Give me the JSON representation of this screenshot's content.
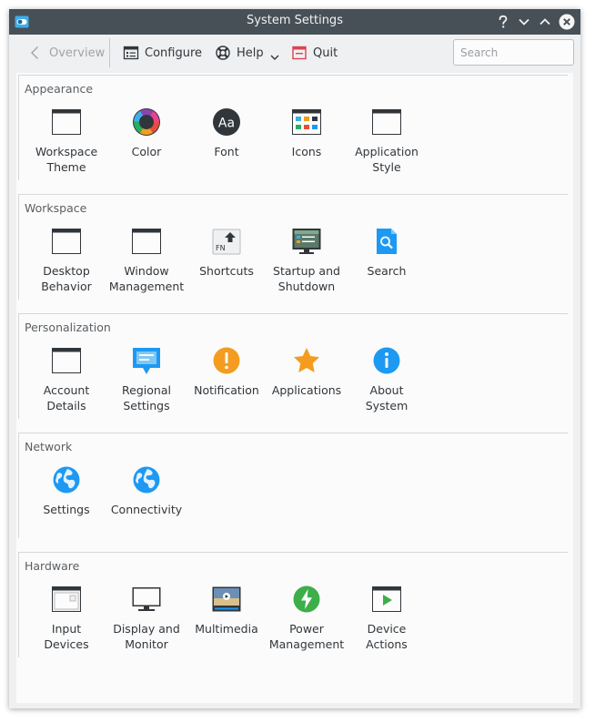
{
  "window": {
    "title": "System Settings"
  },
  "toolbar": {
    "overview_label": "Overview",
    "configure_label": "Configure",
    "help_label": "Help",
    "quit_label": "Quit",
    "search_placeholder": "Search"
  },
  "colors": {
    "titlebar": "#475057",
    "window_bg": "#eff0f1",
    "content_bg": "#fbfbfb",
    "accent": "#3daee9",
    "quit_red": "#da4453"
  },
  "groups": [
    {
      "title": "Appearance",
      "modules": [
        {
          "label": "Workspace\nTheme",
          "icon": "workspace-theme-icon"
        },
        {
          "label": "Color",
          "icon": "color-icon"
        },
        {
          "label": "Font",
          "icon": "font-icon"
        },
        {
          "label": "Icons",
          "icon": "icons-icon"
        },
        {
          "label": "Application\nStyle",
          "icon": "application-style-icon"
        }
      ]
    },
    {
      "title": "Workspace",
      "modules": [
        {
          "label": "Desktop\nBehavior",
          "icon": "desktop-behavior-icon"
        },
        {
          "label": "Window\nManagement",
          "icon": "window-management-icon"
        },
        {
          "label": "Shortcuts",
          "icon": "shortcuts-icon"
        },
        {
          "label": "Startup and\nShutdown",
          "icon": "startup-shutdown-icon"
        },
        {
          "label": "Search",
          "icon": "search-icon"
        }
      ]
    },
    {
      "title": "Personalization",
      "modules": [
        {
          "label": "Account\nDetails",
          "icon": "account-details-icon"
        },
        {
          "label": "Regional\nSettings",
          "icon": "regional-settings-icon"
        },
        {
          "label": "Notification",
          "icon": "notification-icon"
        },
        {
          "label": "Applications",
          "icon": "applications-icon"
        },
        {
          "label": "About\nSystem",
          "icon": "about-system-icon"
        }
      ]
    },
    {
      "title": "Network",
      "modules": [
        {
          "label": "Settings",
          "icon": "network-settings-icon"
        },
        {
          "label": "Connectivity",
          "icon": "connectivity-icon"
        }
      ]
    },
    {
      "title": "Hardware",
      "modules": [
        {
          "label": "Input\nDevices",
          "icon": "input-devices-icon"
        },
        {
          "label": "Display and\nMonitor",
          "icon": "display-monitor-icon"
        },
        {
          "label": "Multimedia",
          "icon": "multimedia-icon"
        },
        {
          "label": "Power\nManagement",
          "icon": "power-management-icon"
        },
        {
          "label": "Device\nActions",
          "icon": "device-actions-icon"
        }
      ]
    }
  ]
}
